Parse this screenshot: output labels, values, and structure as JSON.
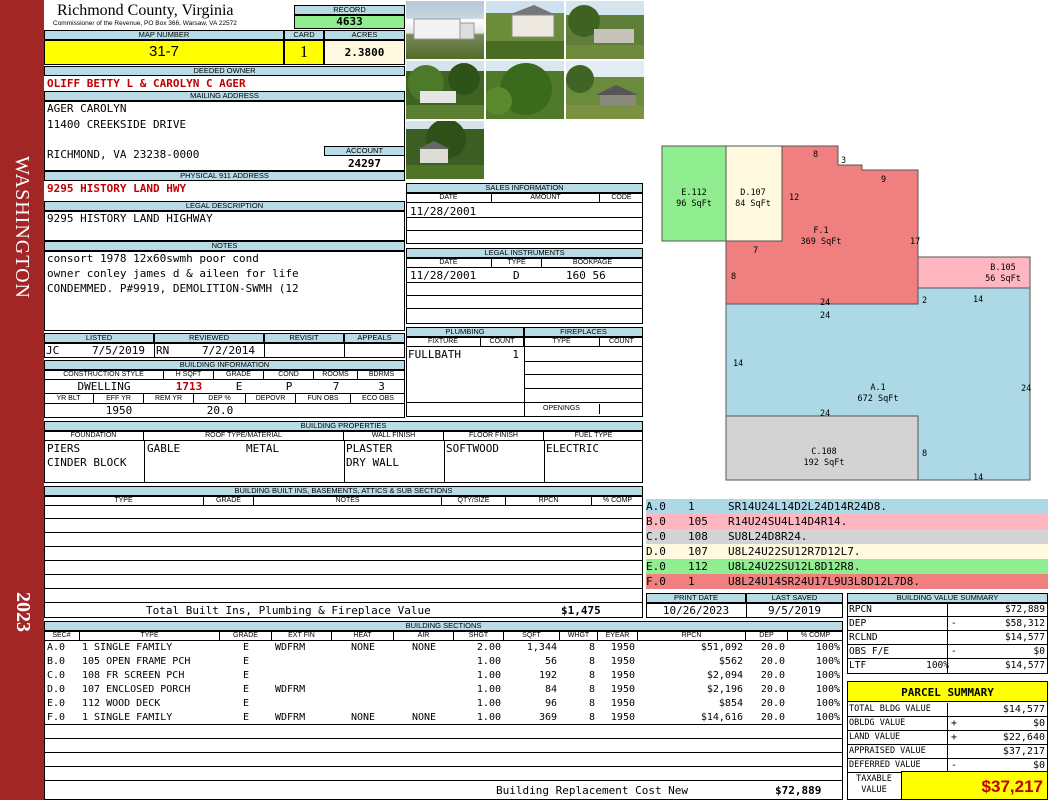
{
  "sidebar": {
    "county_word": "WASHINGTON",
    "year": "2023",
    "color": "#a32626"
  },
  "header": {
    "county": "Richmond County, Virginia",
    "commissioner": "Commissioner of the Revenue, PO Box 366, Warsaw, VA 22572"
  },
  "record": {
    "label": "RECORD",
    "value": "4633"
  },
  "map": {
    "label": "MAP NUMBER",
    "value": "31-7",
    "card_label": "CARD",
    "card": "1",
    "acres_label": "ACRES",
    "acres": "2.3800"
  },
  "owner": {
    "label": "DEEDED OWNER",
    "value": "OLIFF BETTY L & CAROLYN C AGER"
  },
  "mailing": {
    "label": "MAILING ADDRESS",
    "line1": "AGER CAROLYN",
    "line2": "11400 CREEKSIDE DRIVE",
    "line3": "RICHMOND, VA 23238-0000"
  },
  "account": {
    "label": "ACCOUNT",
    "value": "24297"
  },
  "physical": {
    "label": "PHYSICAL 911 ADDRESS",
    "value": "9295 HISTORY LAND HWY"
  },
  "legal": {
    "label": "LEGAL DESCRIPTION",
    "value": "9295 HISTORY LAND HIGHWAY"
  },
  "notes": {
    "label": "NOTES",
    "line1": "consort 1978 12x60swmh poor cond",
    "line2": "owner conley james d & aileen for life",
    "line3": "CONDEMMED. P#9919, DEMOLITION-SWMH (12"
  },
  "sales": {
    "label": "SALES INFORMATION",
    "date_label": "DATE",
    "amount_label": "AMOUNT",
    "code_label": "CODE",
    "date": "11/28/2001"
  },
  "instruments": {
    "label": "LEGAL INSTRUMENTS",
    "date_label": "DATE",
    "type_label": "TYPE",
    "book_label": "BOOKPAGE",
    "date": "11/28/2001",
    "type": "D",
    "bookpage": "160 56"
  },
  "listed": {
    "listed_label": "LISTED",
    "reviewed_label": "REVIEWED",
    "revisit_label": "REVISIT",
    "appeals_label": "APPEALS",
    "listed_by": "JC",
    "listed_date": "7/5/2019",
    "reviewed_by": "RN",
    "reviewed_date": "7/2/2014"
  },
  "building_info": {
    "label": "BUILDING INFORMATION",
    "style_label": "CONSTRUCTION STYLE",
    "hsqft_label": "H SQFT",
    "grade_label": "GRADE",
    "cond_label": "COND",
    "rooms_label": "ROOMS",
    "bdrms_label": "BDRMS",
    "style": "DWELLING",
    "hsqft": "1713",
    "grade": "E",
    "cond": "P",
    "rooms": "7",
    "bdrms": "3",
    "yrblt_label": "YR BLT",
    "effyr_label": "EFF YR",
    "remyr_label": "REM YR",
    "dep_label": "DEP %",
    "depovr_label": "DEPOVR",
    "funobs_label": "FUN OBS",
    "ecoobs_label": "ECO OBS",
    "effyr": "1950",
    "dep": "20.0"
  },
  "plumbing": {
    "label": "PLUMBING",
    "fixture_label": "FIXTURE",
    "count_label": "COUNT",
    "fixture": "FULLBATH",
    "count": "1"
  },
  "fireplaces": {
    "label": "FIREPLACES",
    "type_label": "TYPE",
    "count_label": "COUNT",
    "openings_label": "OPENINGS"
  },
  "properties": {
    "label": "BUILDING PROPERTIES",
    "foundation_label": "FOUNDATION",
    "roof_label": "ROOF TYPE/MATERIAL",
    "wall_label": "WALL FINISH",
    "floor_label": "FLOOR FINISH",
    "fuel_label": "FUEL TYPE",
    "foundation1": "PIERS",
    "foundation2": "CINDER BLOCK",
    "roof_type": "GABLE",
    "roof_mat": "METAL",
    "wall1": "PLASTER",
    "wall2": "DRY WALL",
    "floor": "SOFTWOOD",
    "fuel": "ELECTRIC"
  },
  "builtins": {
    "label": "BUILDING BUILT INS, BASEMENTS, ATTICS & SUB SECTIONS",
    "type_label": "TYPE",
    "grade_label": "GRADE",
    "notes_label": "NOTES",
    "qty_label": "QTY/SIZE",
    "rpcn_label": "RPCN",
    "comp_label": "% COMP",
    "total_label": "Total Built Ins, Plumbing & Fireplace Value",
    "total_value": "$1,475"
  },
  "print": {
    "print_label": "PRINT DATE",
    "saved_label": "LAST SAVED",
    "print_date": "10/26/2023",
    "saved_date": "9/5/2019"
  },
  "sections": {
    "label": "BUILDING SECTIONS",
    "headers": [
      "SEC#",
      "TYPE",
      "GRADE",
      "EXT FIN",
      "HEAT",
      "AIR",
      "SHGT",
      "SQFT",
      "WHGT",
      "EYEAR",
      "RPCN",
      "DEP",
      "% COMP"
    ],
    "rows": [
      {
        "sec": "A.0",
        "type": "1 SINGLE FAMILY",
        "grade": "E",
        "ext": "WDFRM",
        "heat": "NONE",
        "air": "NONE",
        "shgt": "2.00",
        "sqft": "1,344",
        "whgt": "8",
        "eyear": "1950",
        "rpcn": "$51,092",
        "dep": "20.0",
        "comp": "100%"
      },
      {
        "sec": "B.0",
        "type": "105 OPEN FRAME PCH",
        "grade": "E",
        "ext": "",
        "heat": "",
        "air": "",
        "shgt": "1.00",
        "sqft": "56",
        "whgt": "8",
        "eyear": "1950",
        "rpcn": "$562",
        "dep": "20.0",
        "comp": "100%"
      },
      {
        "sec": "C.0",
        "type": "108 FR SCREEN PCH",
        "grade": "E",
        "ext": "",
        "heat": "",
        "air": "",
        "shgt": "1.00",
        "sqft": "192",
        "whgt": "8",
        "eyear": "1950",
        "rpcn": "$2,094",
        "dep": "20.0",
        "comp": "100%"
      },
      {
        "sec": "D.0",
        "type": "107 ENCLOSED PORCH",
        "grade": "E",
        "ext": "WDFRM",
        "heat": "",
        "air": "",
        "shgt": "1.00",
        "sqft": "84",
        "whgt": "8",
        "eyear": "1950",
        "rpcn": "$2,196",
        "dep": "20.0",
        "comp": "100%"
      },
      {
        "sec": "E.0",
        "type": "112 WOOD DECK",
        "grade": "E",
        "ext": "",
        "heat": "",
        "air": "",
        "shgt": "1.00",
        "sqft": "96",
        "whgt": "8",
        "eyear": "1950",
        "rpcn": "$854",
        "dep": "20.0",
        "comp": "100%"
      },
      {
        "sec": "F.0",
        "type": "1 SINGLE FAMILY",
        "grade": "E",
        "ext": "WDFRM",
        "heat": "NONE",
        "air": "NONE",
        "shgt": "1.00",
        "sqft": "369",
        "whgt": "8",
        "eyear": "1950",
        "rpcn": "$14,616",
        "dep": "20.0",
        "comp": "100%"
      }
    ],
    "replacement_label": "Building Replacement Cost New",
    "replacement_value": "$72,889"
  },
  "sketch": {
    "labels": [
      {
        "code": "E.112",
        "area": "96 SqFt"
      },
      {
        "code": "D.107",
        "area": "84 SqFt"
      },
      {
        "code": "F.1",
        "area": "369 SqFt"
      },
      {
        "code": "B.105",
        "area": "56 SqFt"
      },
      {
        "code": "A.1",
        "area": "672 SqFt"
      },
      {
        "code": "C.108",
        "area": "192 SqFt"
      }
    ],
    "dims": [
      "8",
      "3",
      "9",
      "12",
      "17",
      "7",
      "8",
      "24",
      "2",
      "14",
      "24",
      "14",
      "24",
      "24",
      "8",
      "14"
    ],
    "colors": {
      "A": "#add8e6",
      "B": "#ffb6c1",
      "C": "#d3d3d3",
      "D": "#fffadf",
      "E": "#90ee90",
      "F": "#f08080"
    }
  },
  "segments": [
    {
      "sec": "A.0",
      "code": "1",
      "path": "SR14U24L14D2L24D14R24D8.",
      "color": "#add8e6"
    },
    {
      "sec": "B.0",
      "code": "105",
      "path": "R14U24SU4L14D4R14.",
      "color": "#ffb6c1"
    },
    {
      "sec": "C.0",
      "code": "108",
      "path": "SU8L24D8R24.",
      "color": "#d3d3d3"
    },
    {
      "sec": "D.0",
      "code": "107",
      "path": "U8L24U22SU12R7D12L7.",
      "color": "#fffadf"
    },
    {
      "sec": "E.0",
      "code": "112",
      "path": "U8L24U22SU12L8D12R8.",
      "color": "#90ee90"
    },
    {
      "sec": "F.0",
      "code": "1",
      "path": "U8L24U14SR24U17L9U3L8D12L7D8.",
      "color": "#f08080"
    }
  ],
  "value_summary": {
    "label": "BUILDING VALUE SUMMARY",
    "rows": [
      {
        "label": "RPCN",
        "sign": "",
        "pct": "",
        "value": "$72,889"
      },
      {
        "label": "DEP",
        "sign": "-",
        "pct": "",
        "value": "$58,312"
      },
      {
        "label": "RCLND",
        "sign": "",
        "pct": "",
        "value": "$14,577"
      },
      {
        "label": "OBS F/E",
        "sign": "-",
        "pct": "",
        "value": "$0"
      },
      {
        "label": "LTF",
        "sign": "",
        "pct": "100%",
        "value": "$14,577"
      }
    ]
  },
  "parcel": {
    "label": "PARCEL SUMMARY",
    "rows": [
      {
        "label": "TOTAL BLDG VALUE",
        "sign": "",
        "value": "$14,577"
      },
      {
        "label": "OBLDG VALUE",
        "sign": "+",
        "value": "$0"
      },
      {
        "label": "LAND VALUE",
        "sign": "+",
        "value": "$22,640"
      },
      {
        "label": "APPRAISED VALUE",
        "sign": "",
        "value": "$37,217"
      },
      {
        "label": "DEFERRED VALUE",
        "sign": "-",
        "value": "$0"
      }
    ],
    "taxable_label1": "TAXABLE",
    "taxable_label2": "VALUE",
    "taxable_value": "$37,217"
  }
}
